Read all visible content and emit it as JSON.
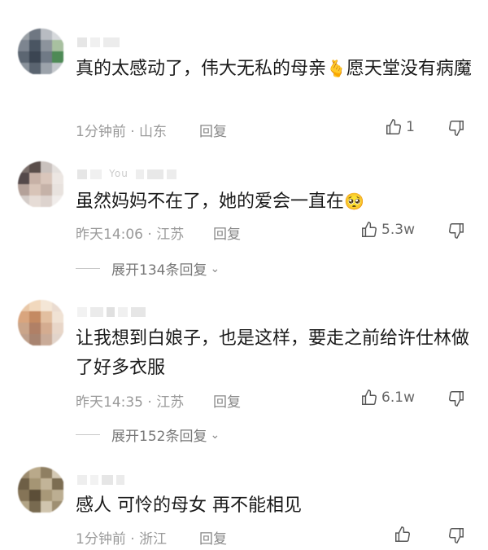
{
  "comments": [
    {
      "text_a": "真的太感动了，伟大无私的母亲",
      "emoji_mid": "🫰",
      "text_b": "愿天堂没有病魔",
      "meta": "1分钟前 · 山东",
      "reply": "回复",
      "likes": "1"
    },
    {
      "name_fragment": "You",
      "text_a": "虽然妈妈不在了，她的爱会一直在",
      "emoji_end": "🥺",
      "meta": "昨天14:06 · 江苏",
      "reply": "回复",
      "likes": "5.3w",
      "expand": "展开134条回复"
    },
    {
      "text_a": "让我想到白娘子，也是这样，要走之前给许仕林做了好多衣服",
      "meta": "昨天14:35 · 江苏",
      "reply": "回复",
      "likes": "6.1w",
      "expand": "展开152条回复"
    },
    {
      "text_a": "感人 可怜的母女 再不能相见",
      "meta": "1分钟前 · 浙江",
      "reply": "回复",
      "likes": ""
    }
  ],
  "icons": {
    "like": "thumbs-up-icon",
    "dislike": "thumbs-down-icon",
    "chevron": "chevron-down-icon"
  },
  "colors": {
    "meta": "#9a9a9a",
    "text": "#1a1a1a"
  }
}
